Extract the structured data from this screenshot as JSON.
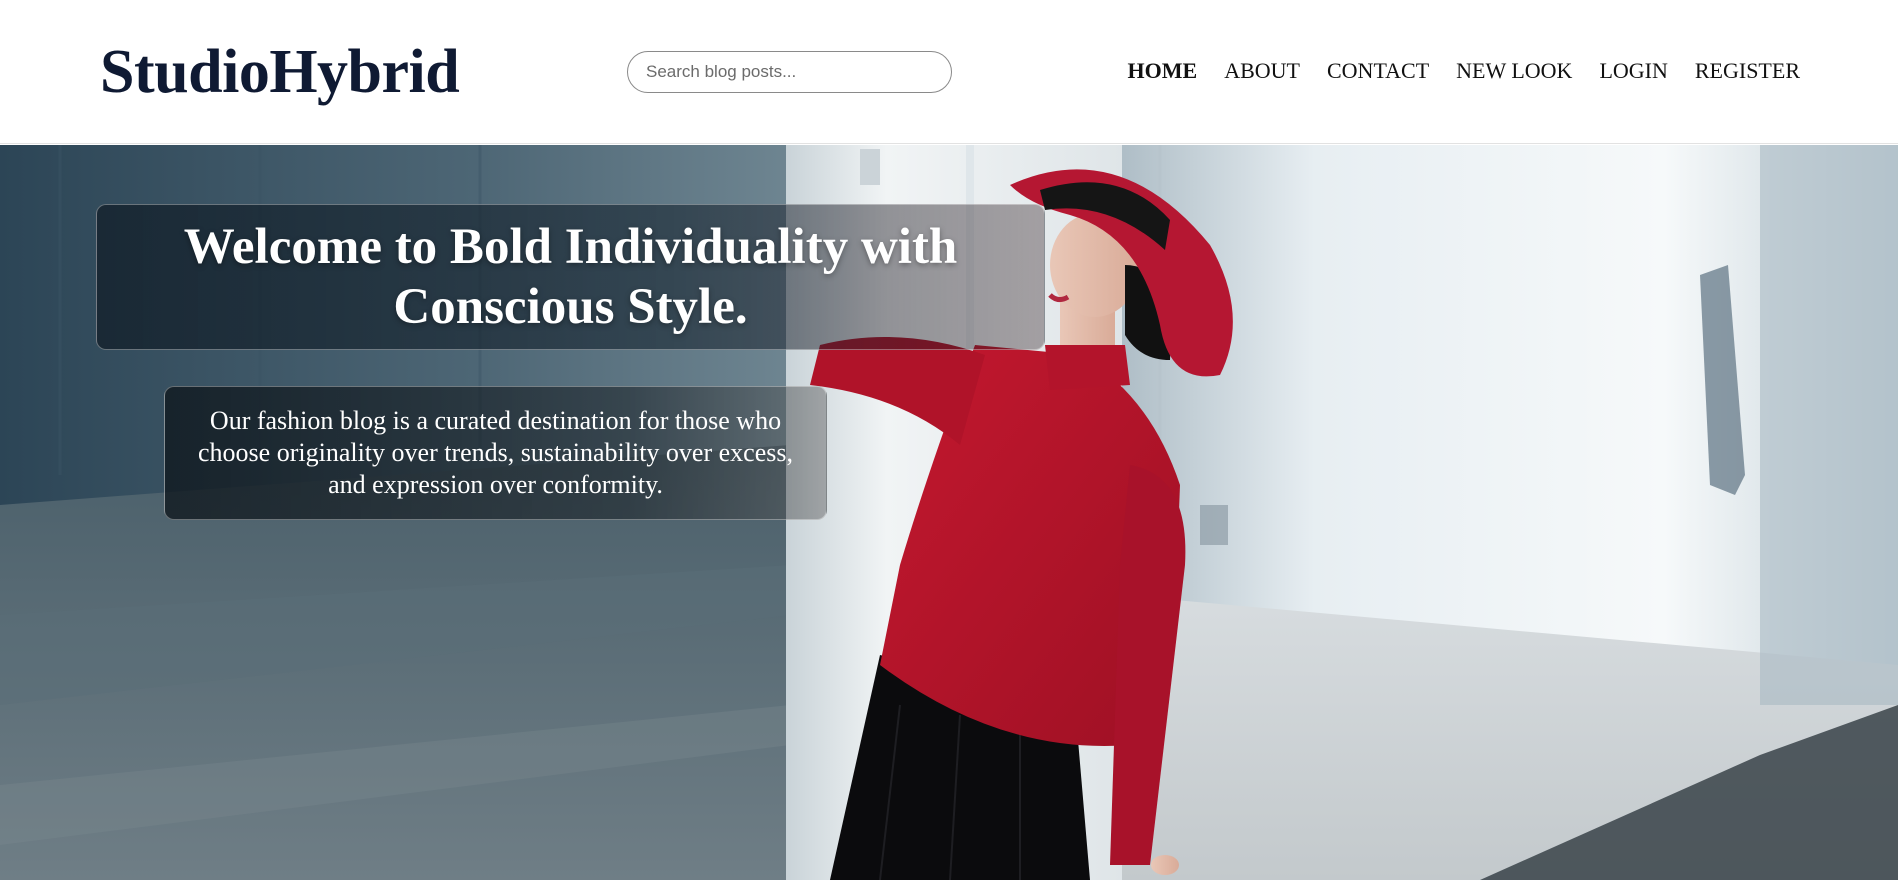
{
  "header": {
    "logo": "StudioHybrid",
    "search": {
      "placeholder": "Search blog posts...",
      "value": ""
    },
    "nav": [
      {
        "label": "HOME",
        "active": true
      },
      {
        "label": "ABOUT",
        "active": false
      },
      {
        "label": "CONTACT",
        "active": false
      },
      {
        "label": "NEW LOOK",
        "active": false
      },
      {
        "label": "LOGIN",
        "active": false
      },
      {
        "label": "REGISTER",
        "active": false
      }
    ]
  },
  "hero": {
    "title": "Welcome to Bold Individuality with Conscious Style.",
    "text": "Our fashion blog is a curated destination for those who choose originality over trends, sustainability over excess, and expression over conformity."
  },
  "colors": {
    "logo": "#0f1a33",
    "hat_and_sweater": "#b4142a",
    "skirt": "#0b0b0d",
    "wall_shadow": "#2f4656"
  }
}
